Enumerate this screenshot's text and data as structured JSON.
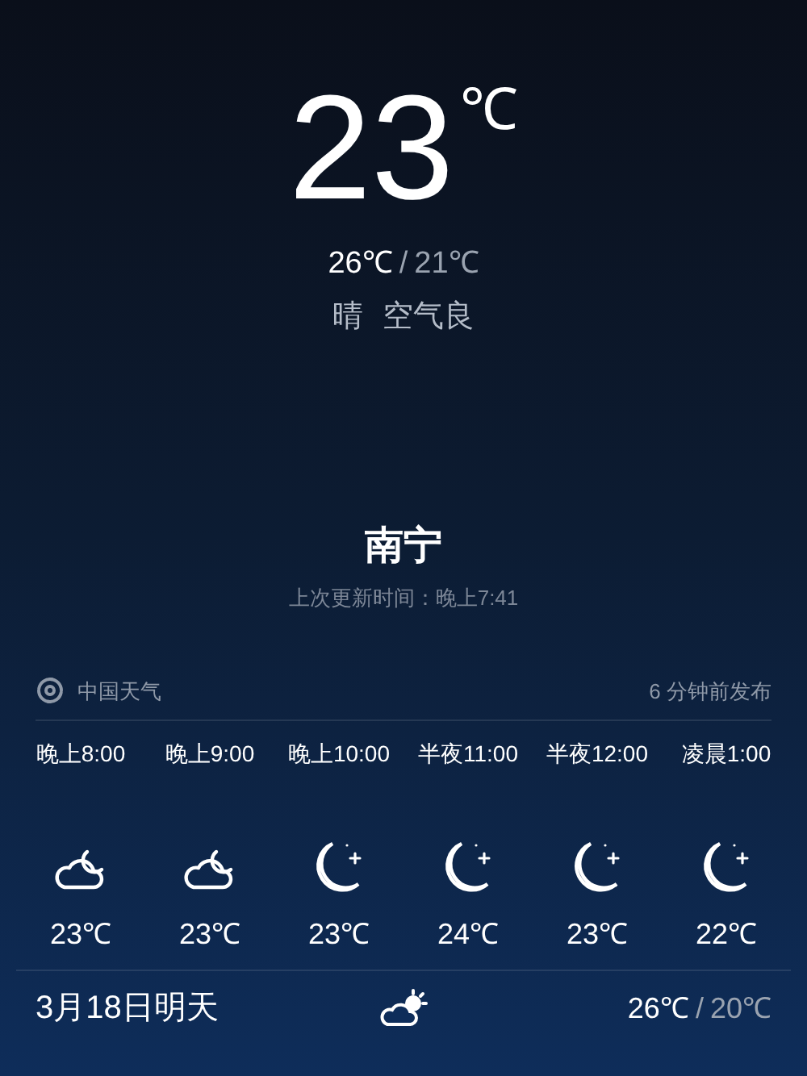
{
  "current": {
    "temperature": "23",
    "unit": "℃",
    "high": "26℃",
    "separator": "/",
    "low": "21℃",
    "condition": "晴",
    "air_quality": "空气良"
  },
  "location": {
    "city": "南宁",
    "updated": "上次更新时间：晚上7:41"
  },
  "source": {
    "name": "中国天气",
    "published": "6 分钟前发布"
  },
  "hourly": [
    {
      "time": "晚上8:00",
      "kind": "cloudy-night",
      "temperature": "23℃"
    },
    {
      "time": "晚上9:00",
      "kind": "cloudy-night",
      "temperature": "23℃"
    },
    {
      "time": "晚上10:00",
      "kind": "clear-night",
      "temperature": "23℃"
    },
    {
      "time": "半夜11:00",
      "kind": "clear-night",
      "temperature": "24℃"
    },
    {
      "time": "半夜12:00",
      "kind": "clear-night",
      "temperature": "23℃"
    },
    {
      "time": "凌晨1:00",
      "kind": "clear-night",
      "temperature": "22℃"
    }
  ],
  "daily": [
    {
      "date": "3月18日明天",
      "kind": "partly-cloudy-day",
      "high": "26℃",
      "separator": "/",
      "low": "20℃"
    }
  ]
}
